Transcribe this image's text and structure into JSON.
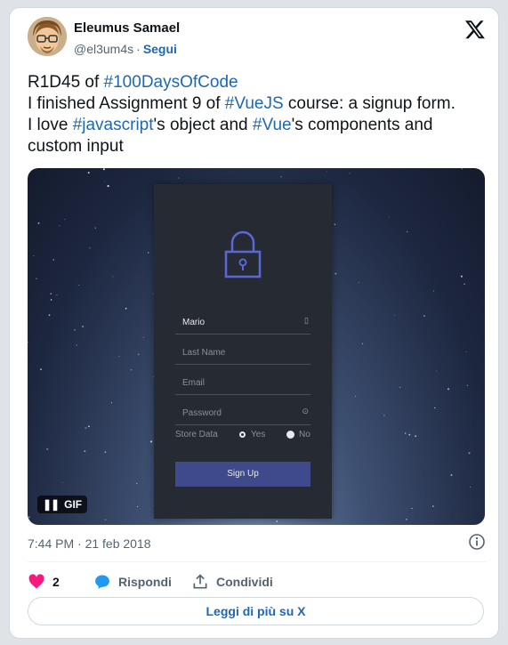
{
  "author": {
    "name": "Eleumus Samael",
    "handle": "@el3um4s",
    "separator": "·",
    "follow_label": "Segui"
  },
  "tweet": {
    "segments": [
      {
        "text": "R1D45 of ",
        "tag": false
      },
      {
        "text": "#100DaysOfCode",
        "tag": true
      },
      {
        "text": "\nI finished Assignment 9 of ",
        "tag": false
      },
      {
        "text": "#VueJS",
        "tag": true
      },
      {
        "text": " course: a signup form.\nI love ",
        "tag": false
      },
      {
        "text": "#javascript",
        "tag": true
      },
      {
        "text": "'s object and ",
        "tag": false
      },
      {
        "text": "#Vue",
        "tag": true
      },
      {
        "text": "'s components and\ncustom input",
        "tag": false
      }
    ]
  },
  "media": {
    "form": {
      "first_name_value": "Mario",
      "last_name_placeholder": "Last Name",
      "email_placeholder": "Email",
      "password_placeholder": "Password",
      "store_label": "Store Data",
      "yes_label": "Yes",
      "no_label": "No",
      "signup_label": "Sign Up"
    },
    "gif_label": "GIF"
  },
  "timestamp": "7:44 PM · 21 feb 2018",
  "actions": {
    "likes": "2",
    "reply_label": "Rispondi",
    "share_label": "Condividi"
  },
  "read_more_label": "Leggi di più su X",
  "colors": {
    "link": "#1d68b4",
    "like": "#f91880",
    "reply_icon": "#1d9bf0"
  }
}
